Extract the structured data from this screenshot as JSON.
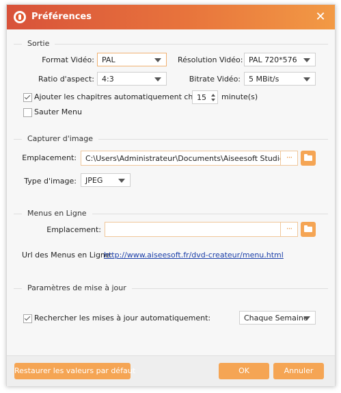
{
  "window": {
    "title": "Préférences",
    "close_glyph": "✕"
  },
  "sortie": {
    "heading": "Sortie",
    "format_video_label": "Format Vidéo:",
    "format_video_value": "PAL",
    "resolution_label": "Résolution Vidéo:",
    "resolution_value": "PAL 720*576",
    "ratio_label": "Ratio d'aspect:",
    "ratio_value": "4:3",
    "bitrate_label": "Bitrate Vidéo:",
    "bitrate_value": "5 MBit/s",
    "chapitres_label": "Ajouter les chapitres automatiquement chaque",
    "chapitres_checked": true,
    "chapitres_value": "15",
    "chapitres_unit": "minute(s)",
    "sauter_menu_label": "Sauter Menu",
    "sauter_menu_checked": false
  },
  "capture": {
    "heading": "Capturer d'image",
    "emplacement_label": "Emplacement:",
    "emplacement_value": "C:\\Users\\Administrateur\\Documents\\Aiseesoft Studio\\Snap",
    "dots": "···",
    "type_label": "Type d'image:",
    "type_value": "JPEG"
  },
  "menus": {
    "heading": "Menus en Ligne",
    "emplacement_label": "Emplacement:",
    "emplacement_value": "",
    "dots": "···",
    "url_label": "Url des Menus en Ligne:",
    "url_value": "http://www.aiseesoft.fr/dvd-createur/menu.html"
  },
  "maj": {
    "heading": "Paramètres de mise à jour",
    "auto_label": "Rechercher les mises à jour automatiquement:",
    "auto_checked": true,
    "frequency_value": "Chaque Semaine"
  },
  "footer": {
    "restore_label": "Restaurer les valeurs par défaut",
    "ok_label": "OK",
    "cancel_label": "Annuler"
  },
  "colors": {
    "accent": "#f5a554",
    "titlebar_start": "#d8523a",
    "titlebar_end": "#f29a45",
    "link": "#1a3ea8"
  }
}
